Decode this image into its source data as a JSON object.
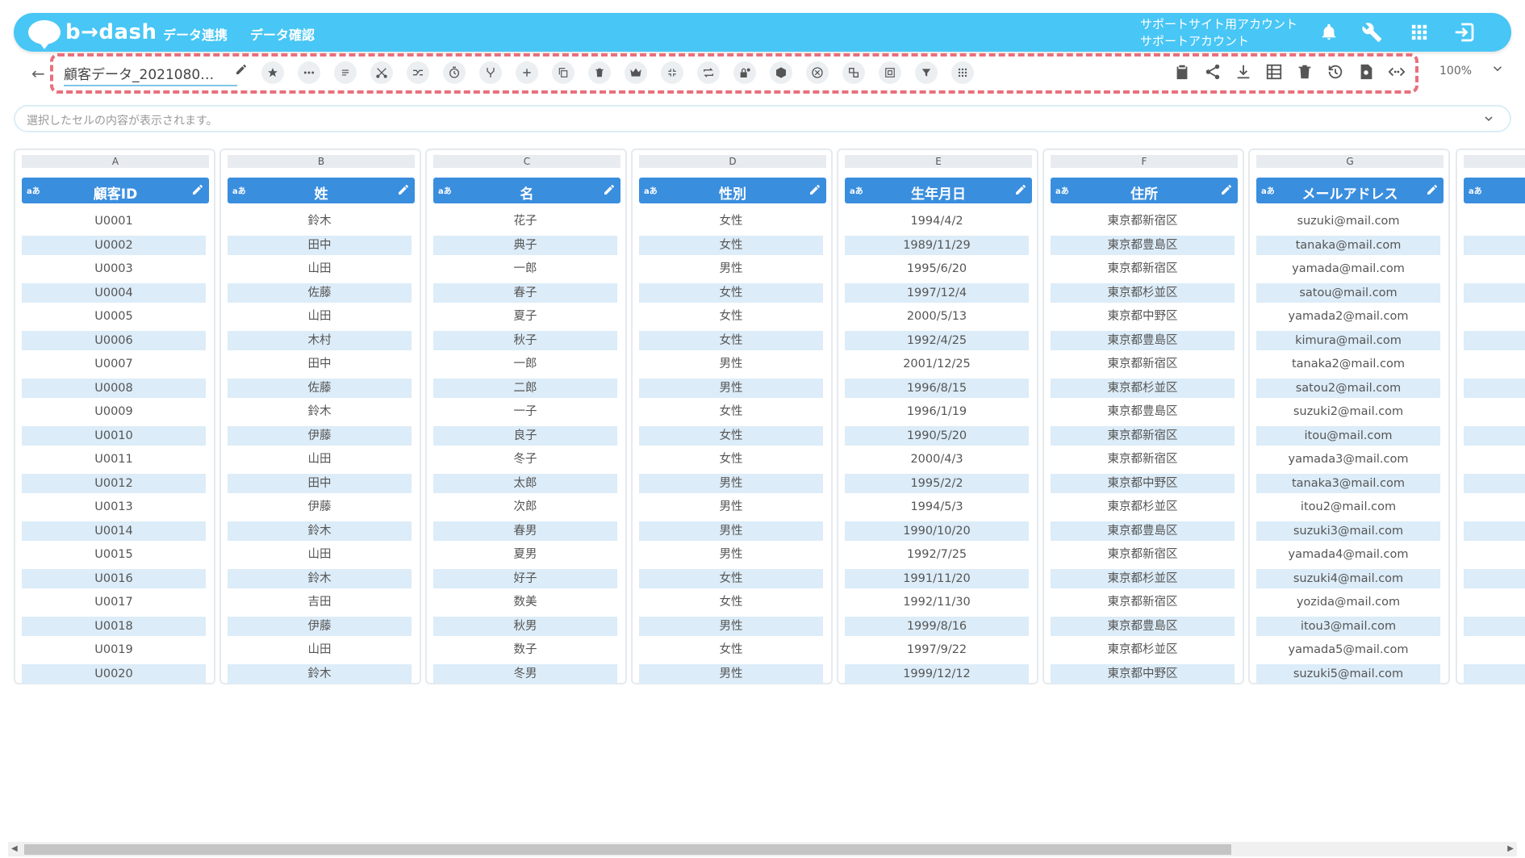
{
  "header": {
    "logo_text": "b→dash",
    "nav": [
      "データ連携",
      "データ確認"
    ],
    "account_line1": "サポートサイト用アカウント",
    "account_line2": "サポートアカウント"
  },
  "toolbar": {
    "filename": "顧客データ_2021080…",
    "zoom": "100%"
  },
  "formula_bar": {
    "placeholder": "選択したセルの内容が表示されます。"
  },
  "columns": [
    {
      "letter": "A",
      "type": "aあ",
      "name": "顧客ID",
      "values": [
        "U0001",
        "U0002",
        "U0003",
        "U0004",
        "U0005",
        "U0006",
        "U0007",
        "U0008",
        "U0009",
        "U0010",
        "U0011",
        "U0012",
        "U0013",
        "U0014",
        "U0015",
        "U0016",
        "U0017",
        "U0018",
        "U0019",
        "U0020"
      ]
    },
    {
      "letter": "B",
      "type": "aあ",
      "name": "姓",
      "values": [
        "鈴木",
        "田中",
        "山田",
        "佐藤",
        "山田",
        "木村",
        "田中",
        "佐藤",
        "鈴木",
        "伊藤",
        "山田",
        "田中",
        "伊藤",
        "鈴木",
        "山田",
        "鈴木",
        "吉田",
        "伊藤",
        "山田",
        "鈴木"
      ]
    },
    {
      "letter": "C",
      "type": "aあ",
      "name": "名",
      "values": [
        "花子",
        "典子",
        "一郎",
        "春子",
        "夏子",
        "秋子",
        "一郎",
        "二郎",
        "一子",
        "良子",
        "冬子",
        "太郎",
        "次郎",
        "春男",
        "夏男",
        "好子",
        "数美",
        "秋男",
        "数子",
        "冬男"
      ]
    },
    {
      "letter": "D",
      "type": "aあ",
      "name": "性別",
      "values": [
        "女性",
        "女性",
        "男性",
        "女性",
        "女性",
        "女性",
        "男性",
        "男性",
        "女性",
        "女性",
        "女性",
        "男性",
        "男性",
        "男性",
        "男性",
        "女性",
        "女性",
        "男性",
        "女性",
        "男性"
      ]
    },
    {
      "letter": "E",
      "type": "aあ",
      "name": "生年月日",
      "values": [
        "1994/4/2",
        "1989/11/29",
        "1995/6/20",
        "1997/12/4",
        "2000/5/13",
        "1992/4/25",
        "2001/12/25",
        "1996/8/15",
        "1996/1/19",
        "1990/5/20",
        "2000/4/3",
        "1995/2/2",
        "1994/5/3",
        "1990/10/20",
        "1992/7/25",
        "1991/11/20",
        "1992/11/30",
        "1999/8/16",
        "1997/9/22",
        "1999/12/12"
      ]
    },
    {
      "letter": "F",
      "type": "aあ",
      "name": "住所",
      "values": [
        "東京都新宿区",
        "東京都豊島区",
        "東京都新宿区",
        "東京都杉並区",
        "東京都中野区",
        "東京都豊島区",
        "東京都新宿区",
        "東京都杉並区",
        "東京都豊島区",
        "東京都新宿区",
        "東京都新宿区",
        "東京都中野区",
        "東京都杉並区",
        "東京都豊島区",
        "東京都新宿区",
        "東京都杉並区",
        "東京都新宿区",
        "東京都豊島区",
        "東京都杉並区",
        "東京都中野区"
      ]
    },
    {
      "letter": "G",
      "type": "aあ",
      "name": "メールアドレス",
      "values": [
        "suzuki@mail.com",
        "tanaka@mail.com",
        "yamada@mail.com",
        "satou@mail.com",
        "yamada2@mail.com",
        "kimura@mail.com",
        "tanaka2@mail.com",
        "satou2@mail.com",
        "suzuki2@mail.com",
        "itou@mail.com",
        "yamada3@mail.com",
        "tanaka3@mail.com",
        "itou2@mail.com",
        "suzuki3@mail.com",
        "yamada4@mail.com",
        "suzuki4@mail.com",
        "yozida@mail.com",
        "itou3@mail.com",
        "yamada5@mail.com",
        "suzuki5@mail.com"
      ]
    }
  ],
  "partial_column": {
    "type": "aあ"
  },
  "colors": {
    "header_bg": "#48c6f5",
    "column_head": "#3a8ede",
    "alt_row": "#dcecf8",
    "highlight": "#e8707c"
  }
}
